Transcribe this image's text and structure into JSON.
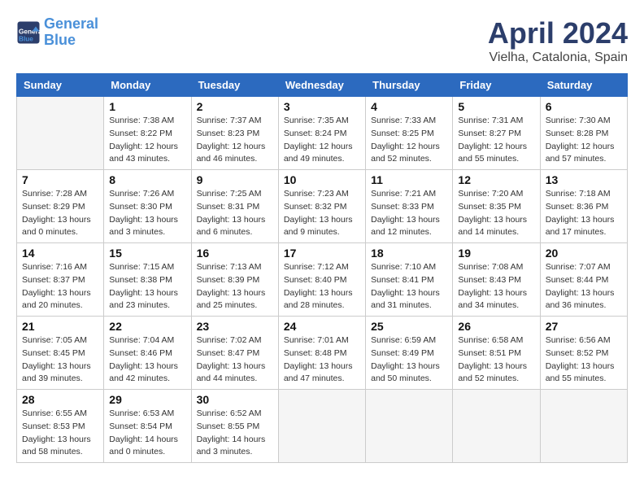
{
  "header": {
    "logo_line1": "General",
    "logo_line2": "Blue",
    "month": "April 2024",
    "location": "Vielha, Catalonia, Spain"
  },
  "weekdays": [
    "Sunday",
    "Monday",
    "Tuesday",
    "Wednesday",
    "Thursday",
    "Friday",
    "Saturday"
  ],
  "weeks": [
    [
      {
        "day": "",
        "sunrise": "",
        "sunset": "",
        "daylight": ""
      },
      {
        "day": "1",
        "sunrise": "Sunrise: 7:38 AM",
        "sunset": "Sunset: 8:22 PM",
        "daylight": "Daylight: 12 hours and 43 minutes."
      },
      {
        "day": "2",
        "sunrise": "Sunrise: 7:37 AM",
        "sunset": "Sunset: 8:23 PM",
        "daylight": "Daylight: 12 hours and 46 minutes."
      },
      {
        "day": "3",
        "sunrise": "Sunrise: 7:35 AM",
        "sunset": "Sunset: 8:24 PM",
        "daylight": "Daylight: 12 hours and 49 minutes."
      },
      {
        "day": "4",
        "sunrise": "Sunrise: 7:33 AM",
        "sunset": "Sunset: 8:25 PM",
        "daylight": "Daylight: 12 hours and 52 minutes."
      },
      {
        "day": "5",
        "sunrise": "Sunrise: 7:31 AM",
        "sunset": "Sunset: 8:27 PM",
        "daylight": "Daylight: 12 hours and 55 minutes."
      },
      {
        "day": "6",
        "sunrise": "Sunrise: 7:30 AM",
        "sunset": "Sunset: 8:28 PM",
        "daylight": "Daylight: 12 hours and 57 minutes."
      }
    ],
    [
      {
        "day": "7",
        "sunrise": "Sunrise: 7:28 AM",
        "sunset": "Sunset: 8:29 PM",
        "daylight": "Daylight: 13 hours and 0 minutes."
      },
      {
        "day": "8",
        "sunrise": "Sunrise: 7:26 AM",
        "sunset": "Sunset: 8:30 PM",
        "daylight": "Daylight: 13 hours and 3 minutes."
      },
      {
        "day": "9",
        "sunrise": "Sunrise: 7:25 AM",
        "sunset": "Sunset: 8:31 PM",
        "daylight": "Daylight: 13 hours and 6 minutes."
      },
      {
        "day": "10",
        "sunrise": "Sunrise: 7:23 AM",
        "sunset": "Sunset: 8:32 PM",
        "daylight": "Daylight: 13 hours and 9 minutes."
      },
      {
        "day": "11",
        "sunrise": "Sunrise: 7:21 AM",
        "sunset": "Sunset: 8:33 PM",
        "daylight": "Daylight: 13 hours and 12 minutes."
      },
      {
        "day": "12",
        "sunrise": "Sunrise: 7:20 AM",
        "sunset": "Sunset: 8:35 PM",
        "daylight": "Daylight: 13 hours and 14 minutes."
      },
      {
        "day": "13",
        "sunrise": "Sunrise: 7:18 AM",
        "sunset": "Sunset: 8:36 PM",
        "daylight": "Daylight: 13 hours and 17 minutes."
      }
    ],
    [
      {
        "day": "14",
        "sunrise": "Sunrise: 7:16 AM",
        "sunset": "Sunset: 8:37 PM",
        "daylight": "Daylight: 13 hours and 20 minutes."
      },
      {
        "day": "15",
        "sunrise": "Sunrise: 7:15 AM",
        "sunset": "Sunset: 8:38 PM",
        "daylight": "Daylight: 13 hours and 23 minutes."
      },
      {
        "day": "16",
        "sunrise": "Sunrise: 7:13 AM",
        "sunset": "Sunset: 8:39 PM",
        "daylight": "Daylight: 13 hours and 25 minutes."
      },
      {
        "day": "17",
        "sunrise": "Sunrise: 7:12 AM",
        "sunset": "Sunset: 8:40 PM",
        "daylight": "Daylight: 13 hours and 28 minutes."
      },
      {
        "day": "18",
        "sunrise": "Sunrise: 7:10 AM",
        "sunset": "Sunset: 8:41 PM",
        "daylight": "Daylight: 13 hours and 31 minutes."
      },
      {
        "day": "19",
        "sunrise": "Sunrise: 7:08 AM",
        "sunset": "Sunset: 8:43 PM",
        "daylight": "Daylight: 13 hours and 34 minutes."
      },
      {
        "day": "20",
        "sunrise": "Sunrise: 7:07 AM",
        "sunset": "Sunset: 8:44 PM",
        "daylight": "Daylight: 13 hours and 36 minutes."
      }
    ],
    [
      {
        "day": "21",
        "sunrise": "Sunrise: 7:05 AM",
        "sunset": "Sunset: 8:45 PM",
        "daylight": "Daylight: 13 hours and 39 minutes."
      },
      {
        "day": "22",
        "sunrise": "Sunrise: 7:04 AM",
        "sunset": "Sunset: 8:46 PM",
        "daylight": "Daylight: 13 hours and 42 minutes."
      },
      {
        "day": "23",
        "sunrise": "Sunrise: 7:02 AM",
        "sunset": "Sunset: 8:47 PM",
        "daylight": "Daylight: 13 hours and 44 minutes."
      },
      {
        "day": "24",
        "sunrise": "Sunrise: 7:01 AM",
        "sunset": "Sunset: 8:48 PM",
        "daylight": "Daylight: 13 hours and 47 minutes."
      },
      {
        "day": "25",
        "sunrise": "Sunrise: 6:59 AM",
        "sunset": "Sunset: 8:49 PM",
        "daylight": "Daylight: 13 hours and 50 minutes."
      },
      {
        "day": "26",
        "sunrise": "Sunrise: 6:58 AM",
        "sunset": "Sunset: 8:51 PM",
        "daylight": "Daylight: 13 hours and 52 minutes."
      },
      {
        "day": "27",
        "sunrise": "Sunrise: 6:56 AM",
        "sunset": "Sunset: 8:52 PM",
        "daylight": "Daylight: 13 hours and 55 minutes."
      }
    ],
    [
      {
        "day": "28",
        "sunrise": "Sunrise: 6:55 AM",
        "sunset": "Sunset: 8:53 PM",
        "daylight": "Daylight: 13 hours and 58 minutes."
      },
      {
        "day": "29",
        "sunrise": "Sunrise: 6:53 AM",
        "sunset": "Sunset: 8:54 PM",
        "daylight": "Daylight: 14 hours and 0 minutes."
      },
      {
        "day": "30",
        "sunrise": "Sunrise: 6:52 AM",
        "sunset": "Sunset: 8:55 PM",
        "daylight": "Daylight: 14 hours and 3 minutes."
      },
      {
        "day": "",
        "sunrise": "",
        "sunset": "",
        "daylight": ""
      },
      {
        "day": "",
        "sunrise": "",
        "sunset": "",
        "daylight": ""
      },
      {
        "day": "",
        "sunrise": "",
        "sunset": "",
        "daylight": ""
      },
      {
        "day": "",
        "sunrise": "",
        "sunset": "",
        "daylight": ""
      }
    ]
  ]
}
